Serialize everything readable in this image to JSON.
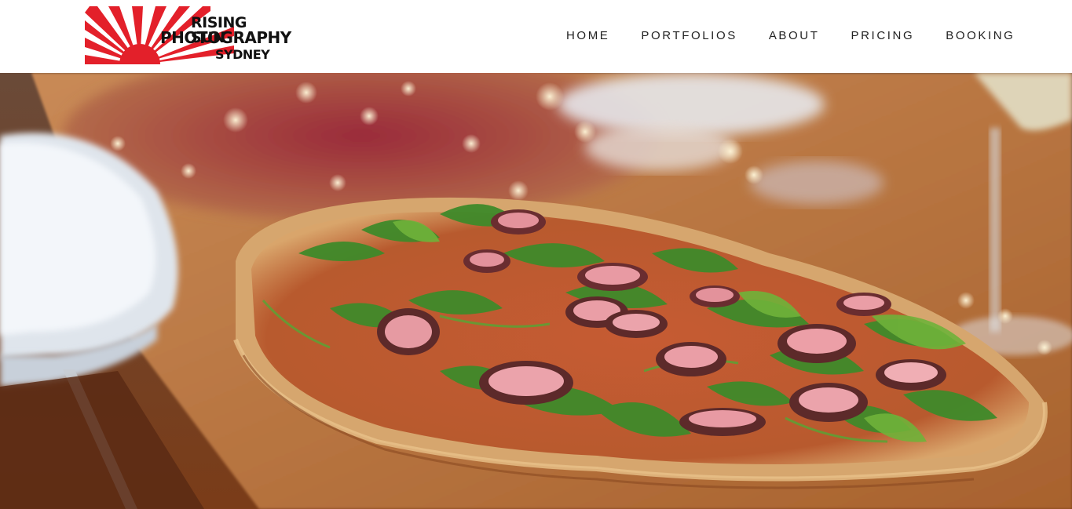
{
  "logo": {
    "line1": "RISING SUN",
    "line2": "PHOTOGRAPHY",
    "line3": "SYDNEY",
    "colors": {
      "rays": "#e3202a",
      "text": "#111111"
    }
  },
  "nav": {
    "items": [
      {
        "label": "HOME"
      },
      {
        "label": "PORTFOLIOS"
      },
      {
        "label": "ABOUT"
      },
      {
        "label": "PRICING"
      },
      {
        "label": "BOOKING"
      }
    ]
  },
  "hero": {
    "subject": "pizza-photo"
  }
}
